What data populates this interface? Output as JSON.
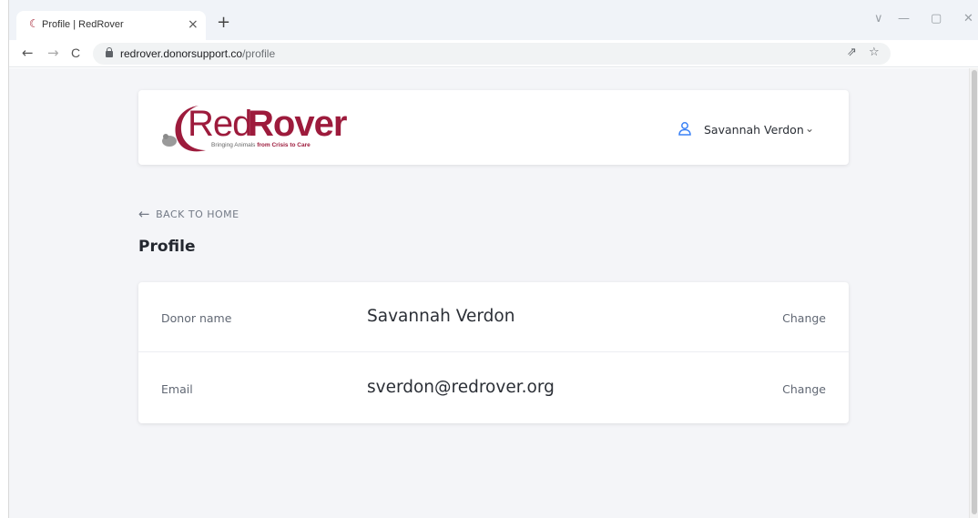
{
  "browser": {
    "tab": {
      "favicon": "☾",
      "title": "Profile | RedRover",
      "close": "×"
    },
    "new_tab": "+",
    "window_controls": {
      "tab_search": "∨",
      "minimize": "—",
      "restore": "▢",
      "close": "✕"
    },
    "nav": {
      "back": "←",
      "forward": "→",
      "reload": "C"
    },
    "url": {
      "host": "redrover.donorsupport.co",
      "path": "/profile"
    },
    "omnibox_icons": {
      "share": "⇗",
      "bookmark": "☆"
    }
  },
  "header": {
    "logo": {
      "red": "Red",
      "rover": "Rover",
      "tagline_prefix": "Bringing Animals ",
      "tagline_bold": "from Crisis to Care",
      "brand_color": "#9d1b3c"
    },
    "user": {
      "name": "Savannah Verdon",
      "chevron": "⌄"
    }
  },
  "nav": {
    "back_arrow": "←",
    "back_label": "BACK TO HOME"
  },
  "page": {
    "title": "Profile"
  },
  "profile": {
    "rows": [
      {
        "label": "Donor name",
        "value": "Savannah Verdon",
        "action": "Change"
      },
      {
        "label": "Email",
        "value": "sverdon@redrover.org",
        "action": "Change"
      }
    ]
  },
  "colors": {
    "accent": "#3b82f6",
    "page_bg": "#f4f5f8"
  }
}
